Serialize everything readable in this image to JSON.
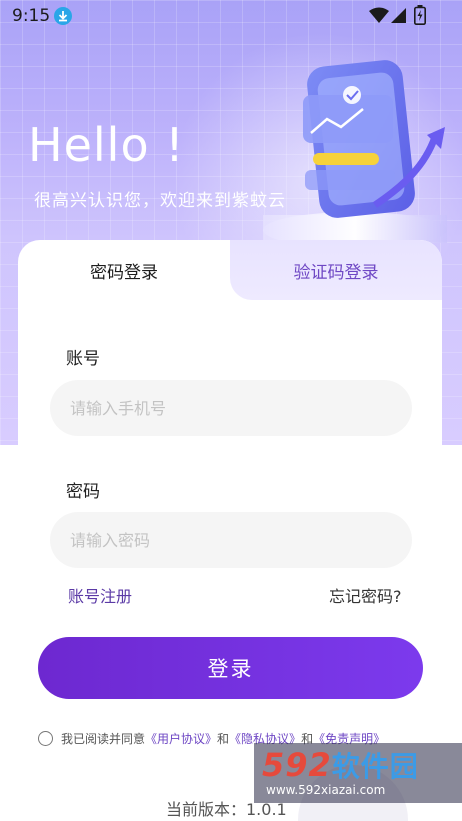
{
  "status_bar": {
    "time": "9:15"
  },
  "hero": {
    "title": "Hello !",
    "subtitle": "很高兴认识您，欢迎来到紫蚊云"
  },
  "tabs": [
    {
      "label": "密码登录",
      "active": true
    },
    {
      "label": "验证码登录",
      "active": false
    }
  ],
  "form": {
    "account_label": "账号",
    "account_placeholder": "请输入手机号",
    "account_value": "",
    "password_label": "密码",
    "password_placeholder": "请输入密码",
    "password_value": "",
    "register_link": "账号注册",
    "forgot_link": "忘记密码?",
    "login_button": "登录"
  },
  "agreement": {
    "prefix": "我已阅读并同意",
    "user_agreement": "《用户协议》",
    "and1": "和",
    "privacy_agreement": "《隐私协议》",
    "and2": "和",
    "disclaimer": "《免责声明》",
    "checked": false
  },
  "version": {
    "text": "当前版本：1.0.1"
  },
  "watermark": {
    "brand_num": "592",
    "brand_cn": "软件园",
    "url": "www.592xiazai.com"
  },
  "colors": {
    "accent": "#7c3aed",
    "link_purple": "#6e47c4",
    "hero_bg": "#bdb2fb"
  },
  "icons": [
    "download-icon",
    "wifi-icon",
    "signal-icon",
    "battery-icon",
    "phone-chart-illustration",
    "radio-unchecked-icon"
  ]
}
